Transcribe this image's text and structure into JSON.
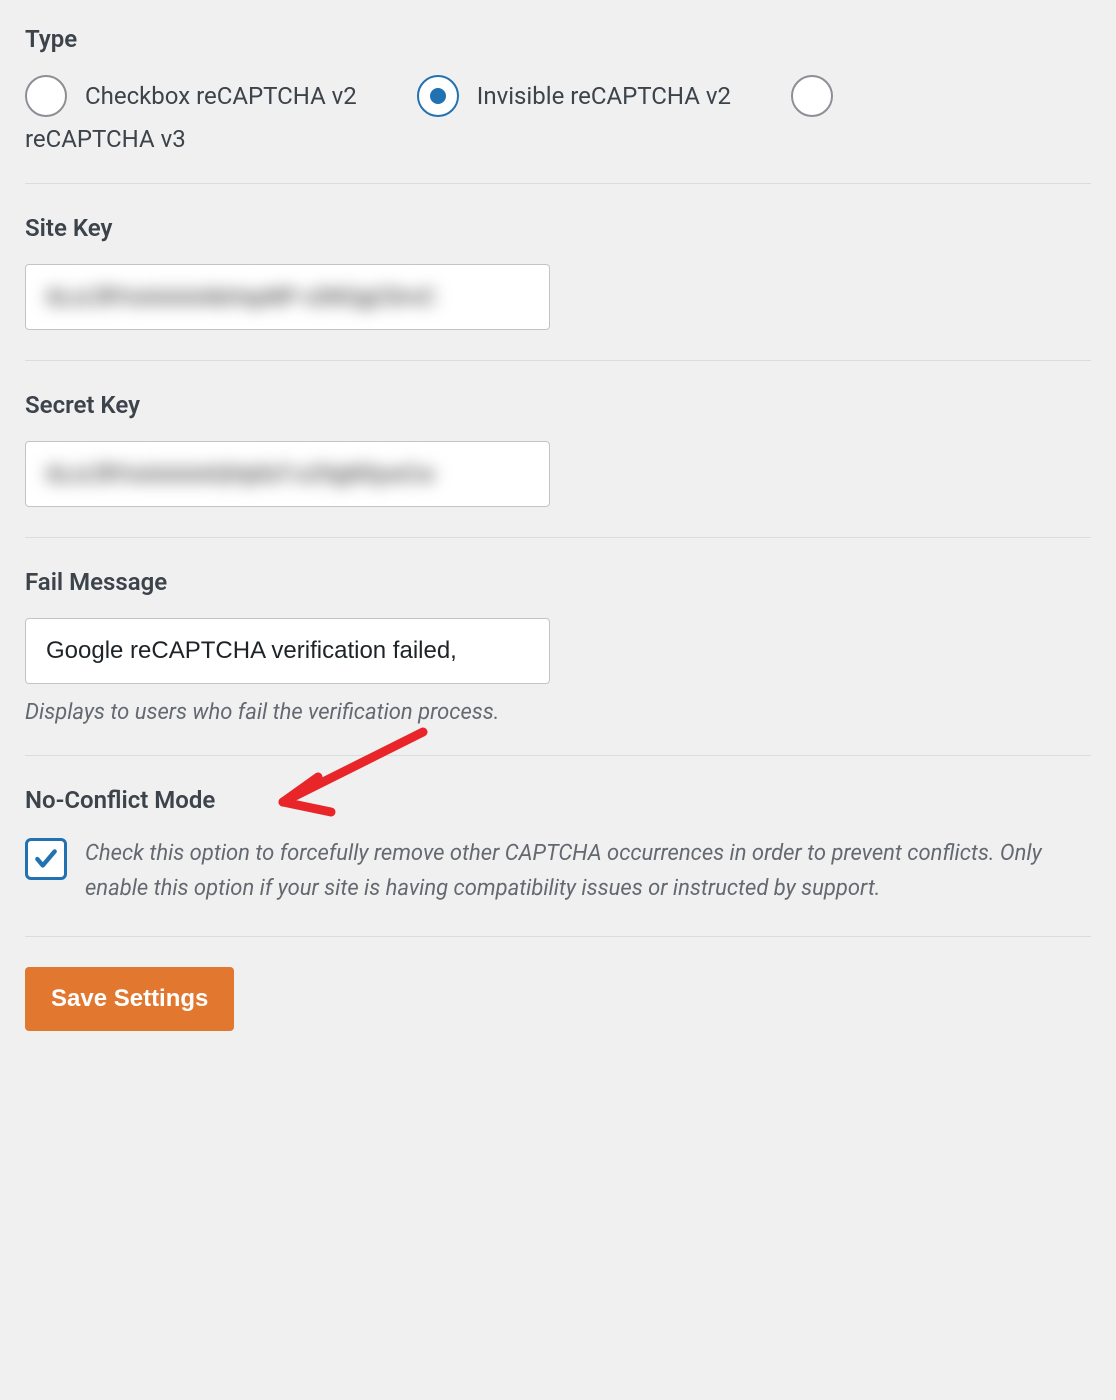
{
  "type": {
    "label": "Type",
    "options": {
      "checkbox": "Checkbox reCAPTCHA v2",
      "invisible": "Invisible reCAPTCHA v2",
      "v3": "reCAPTCHA v3"
    },
    "selected": "invisible"
  },
  "site_key": {
    "label": "Site Key",
    "value": "6LcLf8YsAAAAAbHxpNP-cDKQgCDrvC"
  },
  "secret_key": {
    "label": "Secret Key",
    "value": "6LcLf8YsAAAAAQHpfaT-o29gN5ywCw"
  },
  "fail_message": {
    "label": "Fail Message",
    "value": "Google reCAPTCHA verification failed,",
    "helper": "Displays to users who fail the verification process."
  },
  "no_conflict": {
    "label": "No-Conflict Mode",
    "checked": true,
    "description": "Check this option to forcefully remove other CAPTCHA occurrences in order to prevent conflicts. Only enable this option if your site is having compatibility issues or instructed by support."
  },
  "buttons": {
    "save": "Save Settings"
  }
}
